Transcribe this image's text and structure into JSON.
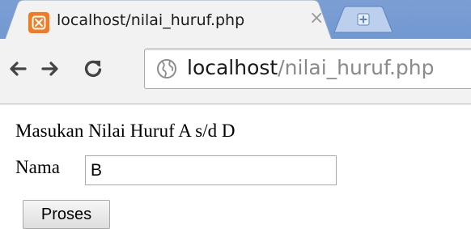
{
  "browser": {
    "tab": {
      "title": "localhost/nilai_huruf.php",
      "close_glyph": "×",
      "favicon": "xampp-icon",
      "favicon_color": "#f47a20"
    },
    "new_tab_icon": "new-tab-icon",
    "nav": {
      "back_icon": "back-arrow-icon",
      "forward_icon": "forward-arrow-icon",
      "reload_icon": "reload-icon"
    },
    "address": {
      "icon": "globe-icon",
      "host": "localhost",
      "path": "/nilai_huruf.php"
    },
    "chrome_color": "#6f96d1"
  },
  "page": {
    "heading": "Masukan Nilai Huruf A s/d D",
    "form": {
      "name_label": "Nama",
      "name_value": "B",
      "submit_label": "Proses"
    }
  }
}
